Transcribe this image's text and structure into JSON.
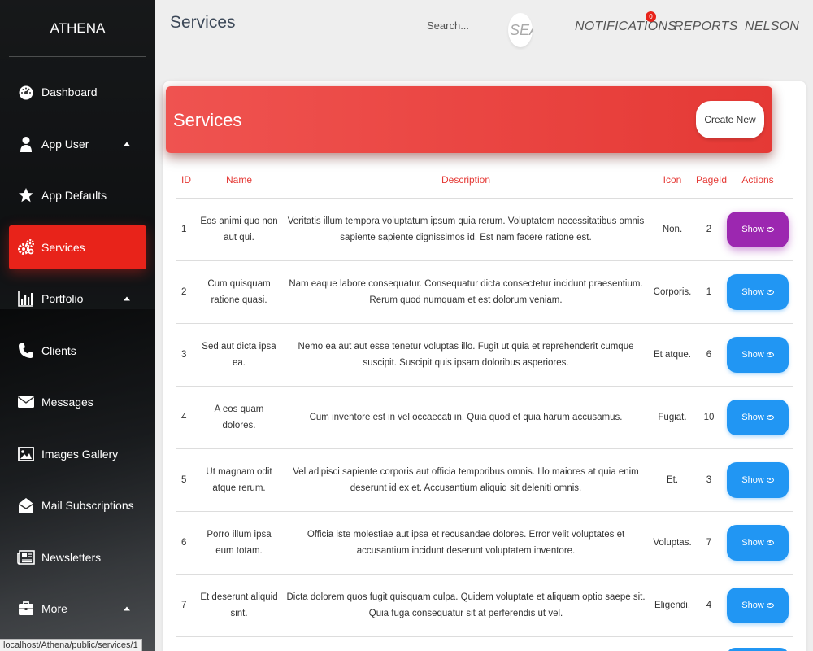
{
  "brand": "ATHENA",
  "sidebar": {
    "items": [
      {
        "label": "Dashboard",
        "icon": "dashboard-icon"
      },
      {
        "label": "App User",
        "icon": "user-icon",
        "caret": true
      },
      {
        "label": "App Defaults",
        "icon": "star-icon"
      },
      {
        "label": "Services",
        "icon": "gears-icon",
        "active": true
      },
      {
        "label": "Portfolio",
        "icon": "bar-chart-icon",
        "caret": true
      },
      {
        "label": "Clients",
        "icon": "phone-icon"
      },
      {
        "label": "Messages",
        "icon": "envelope-icon"
      },
      {
        "label": "Images Gallery",
        "icon": "image-icon"
      },
      {
        "label": "Mail Subscriptions",
        "icon": "open-envelope-icon"
      },
      {
        "label": "Newsletters",
        "icon": "newspaper-icon"
      },
      {
        "label": "More",
        "icon": "briefcase-icon",
        "caret": true
      }
    ]
  },
  "status_url": "localhost/Athena/public/services/1",
  "topbar": {
    "title": "Services",
    "search_placeholder": "Search...",
    "search_button": "SEA",
    "notifications": "NOTIFICATIONS",
    "notifications_count": "0",
    "reports": "REPORTS",
    "user": "NELSON"
  },
  "card": {
    "title": "Services",
    "create_label": "Create New"
  },
  "table": {
    "headers": {
      "id": "ID",
      "name": "Name",
      "description": "Description",
      "icon": "Icon",
      "pageid": "PageId",
      "actions": "Actions"
    },
    "show_label": "Show",
    "rows": [
      {
        "id": "1",
        "name": "Eos animi quo non aut qui.",
        "description": "Veritatis illum tempora voluptatum ipsum quia rerum. Voluptatem necessitatibus omnis sapiente sapiente dignissimos id. Est nam facere ratione est.",
        "icon": "Non.",
        "pageid": "2"
      },
      {
        "id": "2",
        "name": "Cum quisquam ratione quasi.",
        "description": "Nam eaque labore consequatur. Consequatur dicta consectetur incidunt praesentium. Rerum quod numquam et est dolorum veniam.",
        "icon": "Corporis.",
        "pageid": "1"
      },
      {
        "id": "3",
        "name": "Sed aut dicta ipsa ea.",
        "description": "Nemo ea aut aut esse tenetur voluptas illo. Fugit ut quia et reprehenderit cumque suscipit. Suscipit quis ipsam doloribus asperiores.",
        "icon": "Et atque.",
        "pageid": "6"
      },
      {
        "id": "4",
        "name": "A eos quam dolores.",
        "description": "Cum inventore est in vel occaecati in. Quia quod et quia harum accusamus.",
        "icon": "Fugiat.",
        "pageid": "10"
      },
      {
        "id": "5",
        "name": "Ut magnam odit atque rerum.",
        "description": "Vel adipisci sapiente corporis aut officia temporibus omnis. Illo maiores at quia enim deserunt id ex et. Accusantium aliquid sit deleniti omnis.",
        "icon": "Et.",
        "pageid": "3"
      },
      {
        "id": "6",
        "name": "Porro illum ipsa eum totam.",
        "description": "Officia iste molestiae aut ipsa et recusandae dolores. Error velit voluptates et accusantium incidunt deserunt voluptatem inventore.",
        "icon": "Voluptas.",
        "pageid": "7"
      },
      {
        "id": "7",
        "name": "Et deserunt aliquid sint.",
        "description": "Dicta dolorem quos fugit quisquam culpa. Quidem voluptate et aliquam optio saepe sit. Quia fuga consequatur sit at perferendis ut vel.",
        "icon": "Eligendi.",
        "pageid": "4"
      }
    ]
  },
  "colors": {
    "accent": "#e53935",
    "active_nav": "#e8231a",
    "show_button": "#2196f3",
    "show_button_hover": "#9c27b0"
  }
}
